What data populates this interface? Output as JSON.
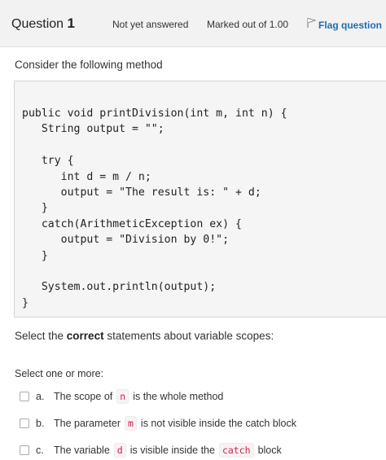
{
  "header": {
    "question_word": "Question",
    "question_number": "1",
    "status": "Not yet answered",
    "marked_out_of": "Marked out of 1.00",
    "flag_label": "Flag question"
  },
  "question": {
    "intro": "Consider the following method",
    "code": "public void printDivision(int m, int n) {\n   String output = \"\";\n\n   try {\n      int d = m / n;\n      output = \"The result is: \" + d;\n   }\n   catch(ArithmeticException ex) {\n      output = \"Division by 0!\";\n   }\n\n   System.out.println(output);\n}",
    "prompt_before": "Select the ",
    "prompt_bold": "correct",
    "prompt_after": " statements about variable scopes:",
    "select_label": "Select one or more:"
  },
  "options": [
    {
      "letter": "a.",
      "before": "The scope of",
      "code": "n",
      "after": "is the whole method"
    },
    {
      "letter": "b.",
      "before": "The parameter",
      "code": "m",
      "after": "is not visible inside the catch block"
    },
    {
      "letter": "c.",
      "before": "The variable",
      "code": "d",
      "after": "is visible inside the",
      "code2": "catch",
      "after2": "block"
    }
  ],
  "colors": {
    "flag_link": "#1f6db4",
    "code_token_text": "#c7254e",
    "header_bg": "#f2f2f2",
    "code_bg": "#f5f5f5"
  },
  "icons": {
    "flag": "flag-icon"
  }
}
